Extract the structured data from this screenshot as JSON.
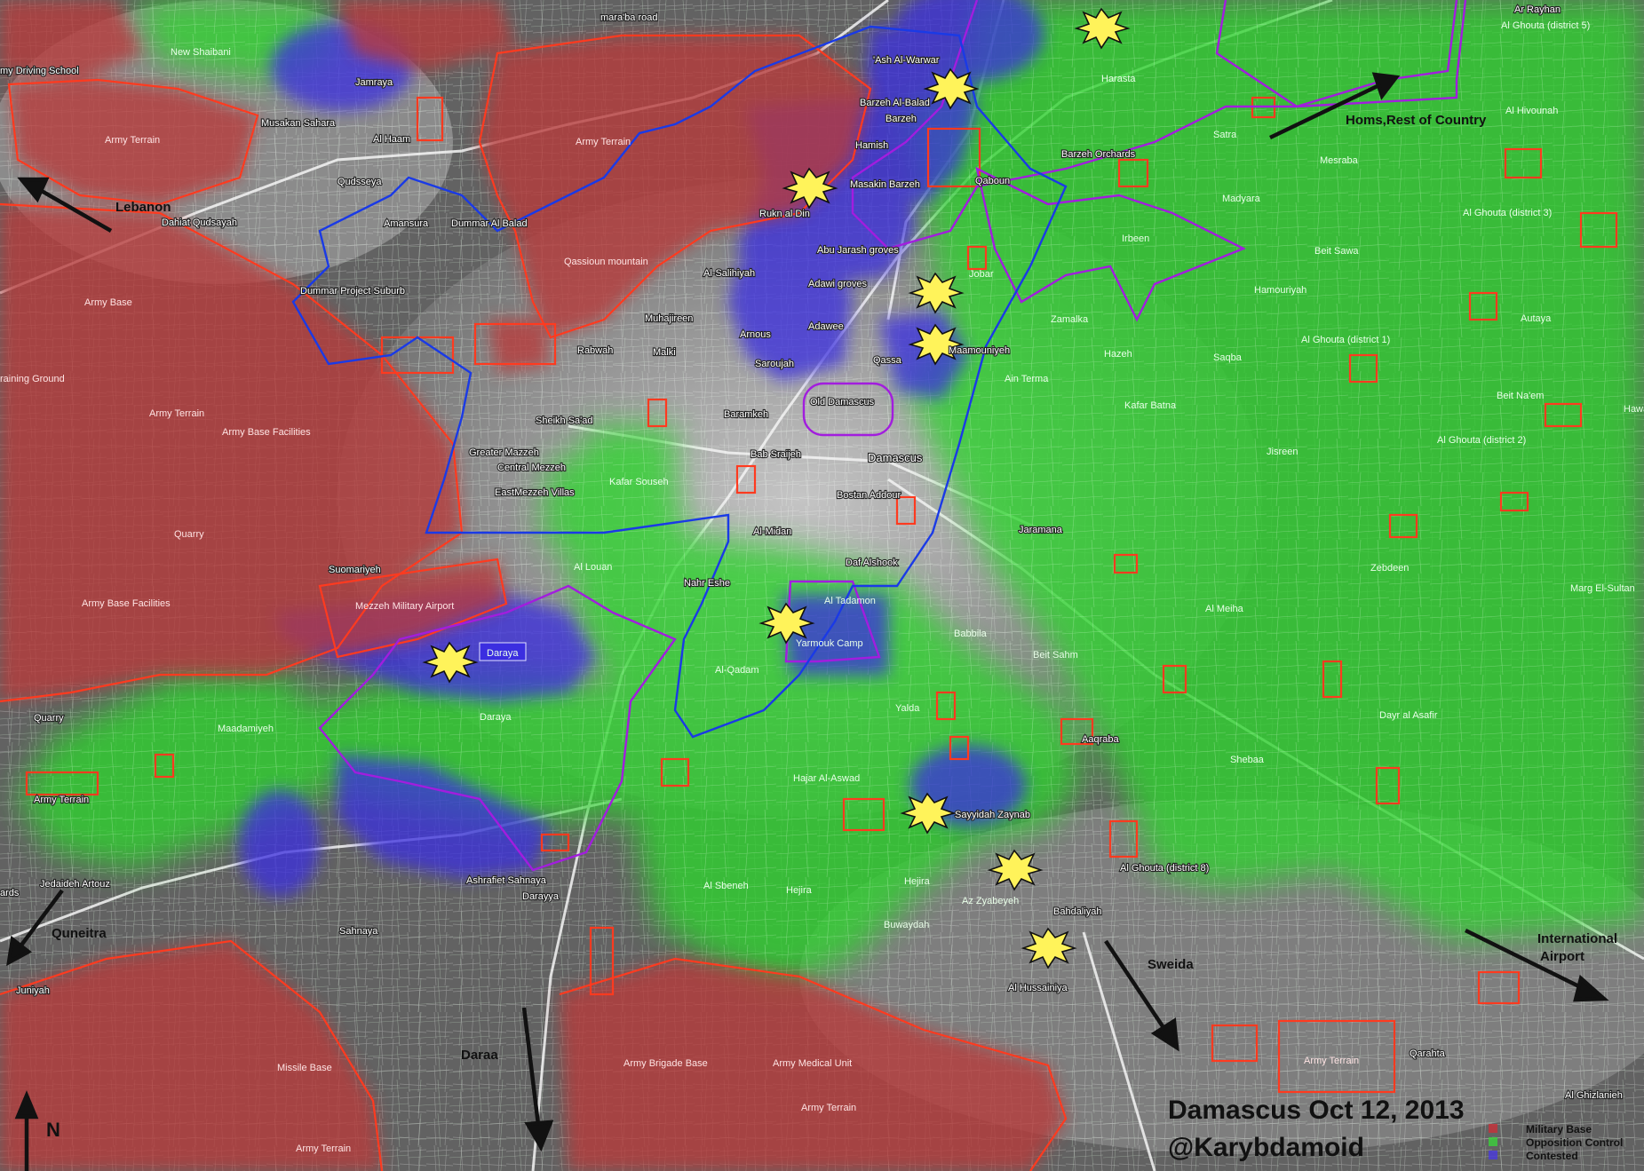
{
  "map": {
    "title": "Damascus Oct 12, 2013",
    "author": "@Karybdamoid",
    "north": "N",
    "legend": [
      {
        "label": "Military Base",
        "color": "#c9313a"
      },
      {
        "label": "Opposition Control",
        "color": "#3bd23b"
      },
      {
        "label": "Contested",
        "color": "#4a3adf"
      }
    ],
    "directions": {
      "lebanon": "Lebanon",
      "homs": "Homs,Rest of Country",
      "quneitra": "Quneitra",
      "daraa": "Daraa",
      "sweida": "Sweida",
      "airport_line1": "International",
      "airport_line2": "Airport"
    },
    "places": {
      "ar_rayhan": "Ar Rayhan",
      "al_ghouta_5": "Al Ghouta (district 5)",
      "maraba_road": "mara'ba road",
      "new_shaibani": "New Shaibani",
      "jamraya": "Jamraya",
      "driving_school": "my Driving School",
      "army_terrain_1": "Army Terrain",
      "musakan_sahara": "Musakan Sahara",
      "al_haam": "Al Haam",
      "army_terrain_2": "Army Terrain",
      "qudsseya": "Qudsseya",
      "dahiat_qudsayah": "Dahiat Qudsayah",
      "amansura": "Amansura",
      "dummar_al_balad": "Dummar Al Balad",
      "qassioun": "Qassioun mountain",
      "dummar_project": "Dummar Project Suburb",
      "army_base_1": "Army Base",
      "training_ground": "raining Ground",
      "army_terrain_3": "Army Terrain",
      "army_base_facilities_1": "Army Base Facilities",
      "quarry_1": "Quarry",
      "suomariyeh": "Suomariyeh",
      "army_base_facilities_2": "Army Base Facilities",
      "mezzeh_airport": "Mezzeh Military Airport",
      "daraya_box": "Daraya",
      "daraya": "Daraya",
      "quarry_2": "Quarry",
      "maadamiyeh": "Maadamiyeh",
      "army_terrain_4": "Army Terrain",
      "jedaideh_artouz": "Jedaideh Artouz",
      "ards": "ards",
      "sahnaya": "Sahnaya",
      "ashrafiet_sahnaya": "Ashrafiet Sahnaya",
      "darayya": "Darayya",
      "juniyah": "Juniyah",
      "missile_base": "Missile Base",
      "army_terrain_5": "Army Terrain",
      "army_brigade_base": "Army Brigade Base",
      "army_medical_unit": "Army Medical Unit",
      "army_terrain_6": "Army Terrain",
      "army_terrain_7": "Army Terrain",
      "ash_al_warwar": "'Ash Al-Warwar",
      "barzeh_al_balad": "Barzeh Al-Balad",
      "barzeh": "Barzeh",
      "hamish": "Hamish",
      "masakin_barzeh": "Masakin Barzeh",
      "qaboun": "Qaboun",
      "rukn_al_din": "Rukn al Din",
      "abu_jarash": "Abu Jarash groves",
      "al_salihiyah": "Al-Salihiyah",
      "adawi_groves": "Adawi groves",
      "jobar": "Jobar",
      "muhajireen": "Muhajireen",
      "arnous": "Arnous",
      "adawee": "Adawee",
      "rabwah": "Rabwah",
      "malki": "Malki",
      "saroujah": "Saroujah",
      "qassa": "Qassa",
      "maamouniyeh": "Maamouniyeh",
      "old_damascus": "Old Damascus",
      "sheikh_saad": "Sheikh Sa'ad",
      "baramkeh": "Baramkeh",
      "greater_mazzeh": "Greater Mazzeh",
      "central_mezzeh": "Central Mezzeh",
      "kafar_souseh": "Kafar Souseh",
      "east_mezzeh": "EastMezzeh Villas",
      "bab_sraijeh": "Bab Sraijeh",
      "damascus": "Damascus",
      "bostan_addour": "Bostan Addour",
      "al_midan": "Al-Midan",
      "daf_alshook": "Daf Alshook",
      "jaramana": "Jaramana",
      "al_louan": "Al Louan",
      "nahr_eshe": "Nahr Eshe",
      "al_tadamon": "Al Tadamon",
      "yarmouk": "Yarmouk Camp",
      "babbila": "Babbila",
      "beit_sahm": "Beit Sahm",
      "al_qadam": "Al-Qadam",
      "yalda": "Yalda",
      "aaqraba": "Aaqraba",
      "hajar_al_aswad": "Hajar Al-Aswad",
      "sayyidah_zaynab": "Sayyidah Zaynab",
      "al_sbeneh": "Al Sbeneh",
      "hejira_1": "Hejira",
      "hejira_2": "Hejira",
      "az_zyabeyeh": "Az Zyabeyeh",
      "buwaydah": "Buwaydah",
      "bahdaliyah": "Bahdaliyah",
      "al_hussainiya": "Al Hussainiya",
      "al_ghouta_8": "Al Ghouta (district 8)",
      "harasta": "Harasta",
      "barzeh_orchards": "Barzeh Orchards",
      "irbeen": "Irbeen",
      "zamalka": "Zamalka",
      "ain_terma": "Ain Terma",
      "hazeh": "Hazeh",
      "kafar_batna": "Kafar Batna",
      "saqba": "Saqba",
      "hamouriyah": "Hamouriyah",
      "beit_sawa": "Beit Sawa",
      "madyara": "Madyara",
      "satra": "Satra",
      "mesraba": "Mesraba",
      "al_hivounah": "Al Hivounah",
      "al_ghouta_3": "Al Ghouta (district 3)",
      "al_ghouta_1": "Al Ghouta (district 1)",
      "autaya": "Autaya",
      "beit_naem": "Beit Na'em",
      "hawa": "Hawa",
      "al_ghouta_2": "Al Ghouta (district 2)",
      "jisreen": "Jisreen",
      "zebdeen": "Zebdeen",
      "marg_el_sultan": "Marg El-Sultan",
      "al_meiha": "Al Meiha",
      "dayr_al_asafir": "Dayr al Asafir",
      "shebaa": "Shebaa",
      "qarahta": "Qarahta",
      "al_ghizlanieh": "Al Ghizlanieh",
      "army_terrain_8": "Army Terrain"
    }
  }
}
